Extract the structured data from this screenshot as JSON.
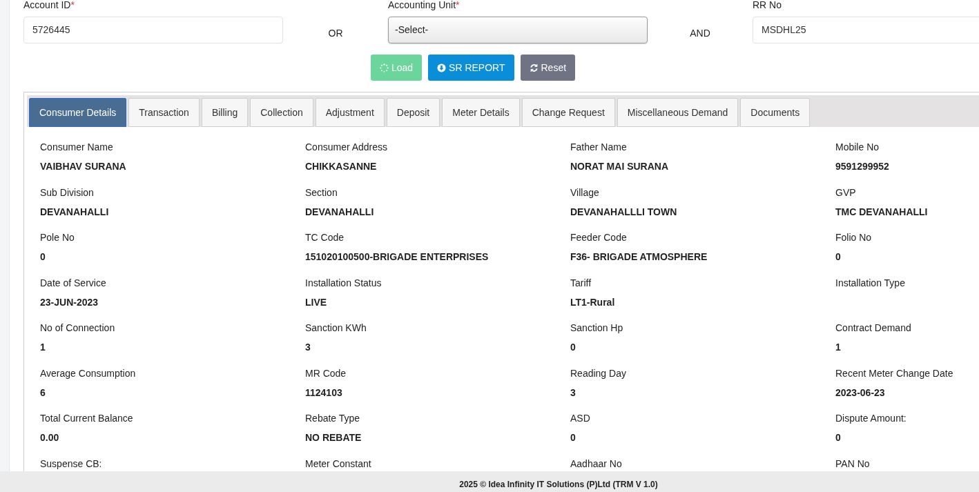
{
  "search_form": {
    "fields": [
      {
        "kind": "input",
        "label": "Account ID",
        "required_mark": "*",
        "value": "5726445"
      },
      {
        "kind": "select",
        "label": "Accounting Unit",
        "required_mark": "*",
        "value": "-Select-"
      },
      {
        "kind": "input",
        "label": "RR No",
        "value": "MSDHL25"
      }
    ],
    "connectors": [
      "OR",
      "AND"
    ],
    "buttons": [
      {
        "kind": "load",
        "label": "Load",
        "disabled": true
      },
      {
        "kind": "report",
        "label": "SR REPORT",
        "disabled": false
      },
      {
        "kind": "reset",
        "label": "Reset",
        "disabled": false
      }
    ]
  },
  "tabs": [
    {
      "label": "Consumer Details",
      "selected": true
    },
    {
      "label": "Transaction",
      "selected": false
    },
    {
      "label": "Billing",
      "selected": false
    },
    {
      "label": "Collection",
      "selected": false
    },
    {
      "label": "Adjustment",
      "selected": false
    },
    {
      "label": "Deposit",
      "selected": false
    },
    {
      "label": "Meter Details",
      "selected": false
    },
    {
      "label": "Change Request",
      "selected": false
    },
    {
      "label": "Miscellaneous Demand",
      "selected": false
    },
    {
      "label": "Documents",
      "selected": false
    }
  ],
  "details": [
    {
      "label": "Consumer Name",
      "value": "VAIBHAV SURANA"
    },
    {
      "label": "Consumer Address",
      "value": "CHIKKASANNE"
    },
    {
      "label": "Father Name",
      "value": "NORAT MAI SURANA"
    },
    {
      "label": "Mobile No",
      "value": "9591299952"
    },
    {
      "label": "Sub Division",
      "value": "DEVANAHALLI"
    },
    {
      "label": "Section",
      "value": "DEVANAHALLI"
    },
    {
      "label": "Village",
      "value": "DEVANAHALLLI TOWN"
    },
    {
      "label": "GVP",
      "value": "TMC DEVANAHALLI"
    },
    {
      "label": "Pole No",
      "value": "0"
    },
    {
      "label": "TC Code",
      "value": "151020100500-BRIGADE ENTERPRISES"
    },
    {
      "label": "Feeder Code",
      "value": "F36- BRIGADE ATMOSPHERE"
    },
    {
      "label": "Folio No",
      "value": "0"
    },
    {
      "label": "Date of Service",
      "value": "23-JUN-2023"
    },
    {
      "label": "Installation Status",
      "value": "LIVE"
    },
    {
      "label": "Tariff",
      "value": "LT1-Rural"
    },
    {
      "label": "Installation Type"
    },
    {
      "label": "No of Connection",
      "value": "1"
    },
    {
      "label": "Sanction KWh",
      "value": "3"
    },
    {
      "label": "Sanction Hp",
      "value": "0"
    },
    {
      "label": "Contract Demand",
      "value": "1"
    },
    {
      "label": "Average Consumption",
      "value": "6"
    },
    {
      "label": "MR Code",
      "value": "1124103"
    },
    {
      "label": "Reading Day",
      "value": "3"
    },
    {
      "label": "Recent Meter Change Date",
      "value": "2023-06-23"
    },
    {
      "label": "Total Current Balance",
      "value": "0.00"
    },
    {
      "label": "Rebate Type",
      "value": "NO REBATE"
    },
    {
      "label": "ASD",
      "value": "0"
    },
    {
      "label": "Dispute Amount:",
      "value": "0"
    },
    {
      "label": "Suspense CB:"
    },
    {
      "label": "Meter Constant"
    },
    {
      "label": "Aadhaar No"
    },
    {
      "label": "PAN No"
    }
  ],
  "footer": {
    "text": "2025 © Idea Infinity IT Solutions (P)Ltd (TRM V 1.0)"
  }
}
